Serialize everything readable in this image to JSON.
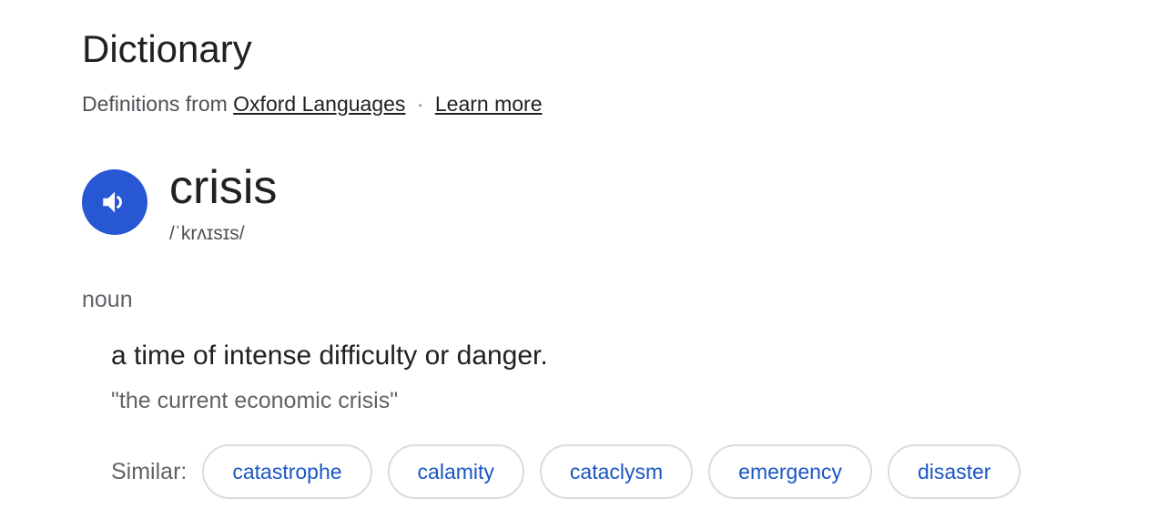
{
  "header": {
    "title": "Dictionary",
    "source_prefix": "Definitions from",
    "source_link": "Oxford Languages",
    "separator": "·",
    "learn_more": "Learn more"
  },
  "entry": {
    "word": "crisis",
    "phonetic": "/ˈkrʌɪsɪs/",
    "part_of_speech": "noun",
    "definition": "a time of intense difficulty or danger.",
    "example": "\"the current economic crisis\"",
    "similar_label": "Similar:",
    "similar": [
      "catastrophe",
      "calamity",
      "cataclysm",
      "emergency",
      "disaster"
    ]
  },
  "colors": {
    "speaker_button": "#2857d4",
    "link_chip_text": "#1a56c4",
    "chip_border": "#dadce0"
  },
  "icons": {
    "speaker": "speaker-icon"
  }
}
